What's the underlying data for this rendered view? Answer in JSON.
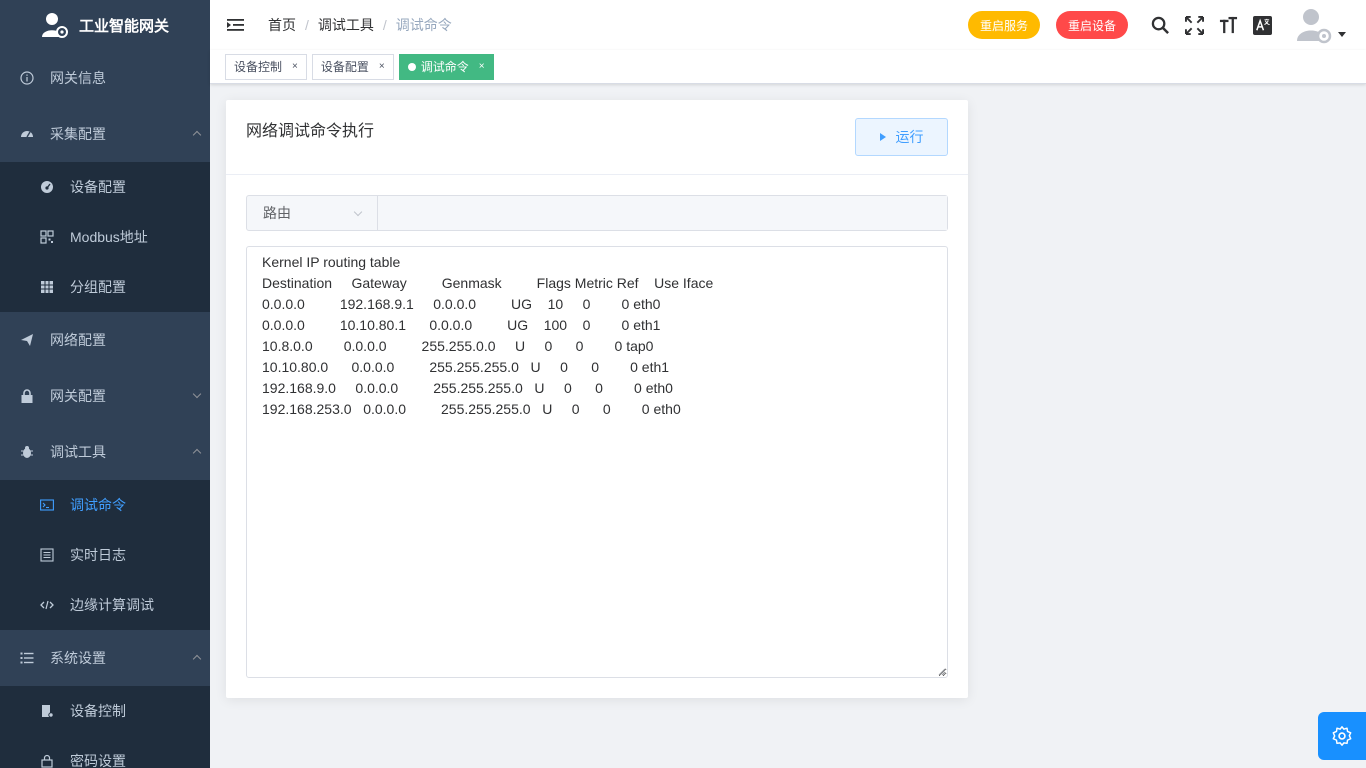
{
  "brand": {
    "title": "工业智能网关"
  },
  "sidebar": {
    "items": [
      {
        "label": "网关信息",
        "icon": "info-icon"
      },
      {
        "label": "采集配置",
        "icon": "dashboard-icon",
        "expanded": true,
        "children": [
          {
            "label": "设备配置",
            "icon": "gauge-icon"
          },
          {
            "label": "Modbus地址",
            "icon": "qrcode-icon"
          },
          {
            "label": "分组配置",
            "icon": "table-icon"
          }
        ]
      },
      {
        "label": "网络配置",
        "icon": "send-icon"
      },
      {
        "label": "网关配置",
        "icon": "lock-icon",
        "expanded": false
      },
      {
        "label": "调试工具",
        "icon": "bug-icon",
        "expanded": true,
        "children": [
          {
            "label": "调试命令",
            "icon": "terminal-icon",
            "active": true
          },
          {
            "label": "实时日志",
            "icon": "log-icon"
          },
          {
            "label": "边缘计算调试",
            "icon": "code-icon"
          }
        ]
      },
      {
        "label": "系统设置",
        "icon": "list-icon",
        "expanded": true,
        "children": [
          {
            "label": "设备控制",
            "icon": "device-icon"
          },
          {
            "label": "密码设置",
            "icon": "key-icon"
          }
        ]
      }
    ]
  },
  "breadcrumb": [
    "首页",
    "调试工具",
    "调试命令"
  ],
  "header": {
    "restart_service": "重启服务",
    "restart_device": "重启设备"
  },
  "tags": [
    {
      "label": "设备控制",
      "active": false
    },
    {
      "label": "设备配置",
      "active": false
    },
    {
      "label": "调试命令",
      "active": true
    }
  ],
  "card": {
    "title": "网络调试命令执行",
    "run_label": "运行",
    "select_value": "路由",
    "command_value": "",
    "output": "Kernel IP routing table\nDestination     Gateway         Genmask         Flags Metric Ref    Use Iface\n0.0.0.0         192.168.9.1     0.0.0.0         UG    10     0        0 eth0\n0.0.0.0         10.10.80.1      0.0.0.0         UG    100    0        0 eth1\n10.8.0.0        0.0.0.0         255.255.0.0     U     0      0        0 tap0\n10.10.80.0      0.0.0.0         255.255.255.0   U     0      0        0 eth1\n192.168.9.0     0.0.0.0         255.255.255.0   U     0      0        0 eth0\n192.168.253.0   0.0.0.0         255.255.255.0   U     0      0        0 eth0"
  },
  "colors": {
    "sidebar_bg": "#304156",
    "submenu_bg": "#1f2d3d",
    "active": "#409eff",
    "tag_active": "#42b983"
  }
}
